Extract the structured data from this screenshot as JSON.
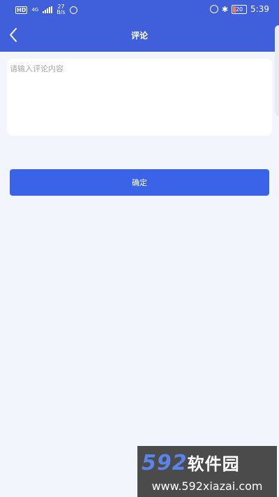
{
  "statusbar": {
    "hd": "HD",
    "network": "4G",
    "speed_value": "27",
    "speed_unit": "B/s",
    "battery": "20",
    "time": "5:39"
  },
  "header": {
    "title": "评论"
  },
  "comment": {
    "placeholder": "请输入评论内容",
    "value": ""
  },
  "actions": {
    "confirm_label": "确定"
  },
  "watermark": {
    "logo_number": "592",
    "logo_text": "软件园",
    "url": "www.592xiazai.com"
  },
  "colors": {
    "header_bg": "#3f5fdb",
    "button_bg": "#3a63e8",
    "page_bg": "#f3f5fc"
  }
}
